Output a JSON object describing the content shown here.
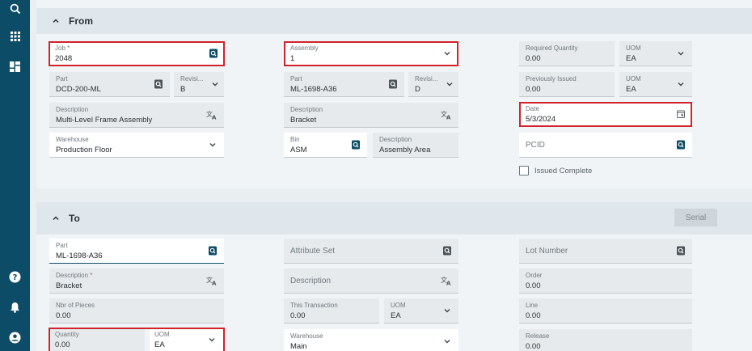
{
  "colors": {
    "rail": "#0d4c66",
    "highlight": "#d2232a",
    "accent": "#0d4c66"
  },
  "rail": {
    "icons": [
      "search-icon",
      "grid-apps-icon",
      "dashboard-icon",
      "help-icon",
      "bell-icon",
      "user-icon"
    ]
  },
  "from": {
    "title": "From",
    "job": {
      "label": "Job *",
      "value": "2048"
    },
    "part": {
      "label": "Part",
      "value": "DCD-200-ML"
    },
    "revision": {
      "label": "Revisi...",
      "value": "B"
    },
    "description": {
      "label": "Description",
      "value": "Multi-Level Frame Assembly"
    },
    "warehouse": {
      "label": "Warehouse",
      "value": "Production Floor"
    },
    "assembly": {
      "label": "Assembly",
      "value": "1"
    },
    "assembly_part": {
      "label": "Part",
      "value": "ML-1698-A36"
    },
    "assembly_revision": {
      "label": "Revisi...",
      "value": "D"
    },
    "assembly_description": {
      "label": "Description",
      "value": "Bracket"
    },
    "bin": {
      "label": "Bin",
      "value": "ASM"
    },
    "bin_description": {
      "label": "Description",
      "value": "Assembly Area"
    },
    "required_quantity": {
      "label": "Required Quantity",
      "value": "0.00"
    },
    "required_uom": {
      "label": "UOM",
      "value": "EA"
    },
    "previously_issued": {
      "label": "Previously Issued",
      "value": "0.00"
    },
    "previously_uom": {
      "label": "UOM",
      "value": "EA"
    },
    "date": {
      "label": "Date",
      "value": "5/3/2024"
    },
    "pcid": {
      "placeholder": "PCID"
    },
    "issued_complete": {
      "label": "Issued Complete"
    }
  },
  "to": {
    "title": "To",
    "serial_label": "Serial",
    "part": {
      "label": "Part",
      "value": "ML-1698-A36"
    },
    "description": {
      "label": "Description *",
      "value": "Bracket"
    },
    "nbr_pieces": {
      "label": "Nbr of Pieces",
      "value": "0.00"
    },
    "quantity": {
      "label": "Quantity",
      "value": "0.00"
    },
    "quantity_uom": {
      "label": "UOM",
      "value": "EA"
    },
    "attribute_set": {
      "placeholder": "Attribute Set"
    },
    "description2": {
      "placeholder": "Description"
    },
    "this_transaction": {
      "label": "This Transaction",
      "value": "0.00"
    },
    "this_uom": {
      "label": "UOM",
      "value": "EA"
    },
    "warehouse": {
      "label": "Warehouse",
      "value": "Main"
    },
    "lot_number": {
      "placeholder": "Lot Number"
    },
    "order": {
      "label": "Order",
      "value": "0.00"
    },
    "line": {
      "label": "Line",
      "value": "0.00"
    },
    "release": {
      "label": "Release",
      "value": "0.00"
    }
  }
}
